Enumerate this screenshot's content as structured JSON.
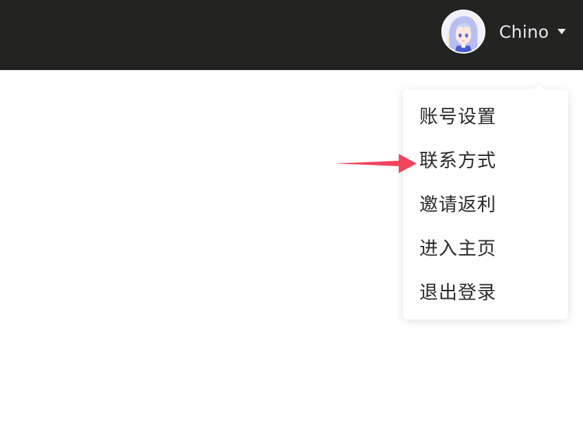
{
  "topbar": {
    "username": "Chino",
    "avatar_icon": "anime-avatar-icon",
    "caret_icon": "caret-down-icon",
    "background_color": "#232422"
  },
  "menu": {
    "items": [
      {
        "label": "账号设置"
      },
      {
        "label": "联系方式"
      },
      {
        "label": "邀请返利"
      },
      {
        "label": "进入主页"
      },
      {
        "label": "退出登录"
      }
    ]
  },
  "annotation": {
    "arrow_icon": "pointer-arrow-icon",
    "arrow_color": "#f4435c",
    "points_to": "联系方式"
  }
}
